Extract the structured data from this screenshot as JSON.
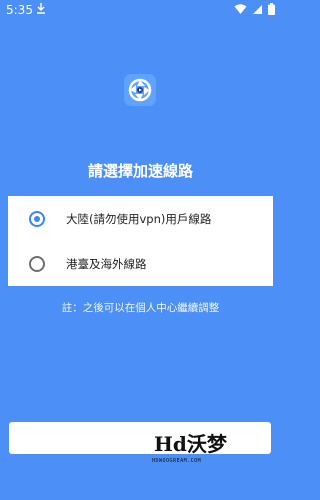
{
  "status_bar": {
    "time": "5:35",
    "icons": [
      "download-icon",
      "wifi-icon",
      "signal-icon",
      "battery-icon"
    ]
  },
  "app": {
    "logo_icon": "play-reel-logo"
  },
  "title": "請選擇加速線路",
  "options": [
    {
      "label": "大陸(請勿使用vpn)用戶線路",
      "selected": true
    },
    {
      "label": "港臺及海外線路",
      "selected": false
    }
  ],
  "note": "註：之後可以在個人中心繼續調整",
  "watermark": {
    "text": "Hd沃梦",
    "subtext": "HDWOOGREAM.COM"
  },
  "colors": {
    "background": "#4c8ff7",
    "accent": "#3a86f2"
  }
}
